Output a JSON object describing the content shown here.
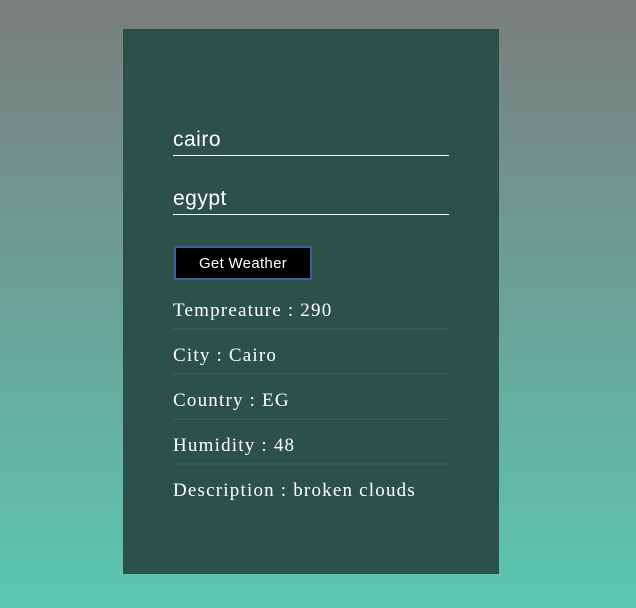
{
  "form": {
    "city_value": "cairo",
    "country_value": "egypt",
    "button_label": "Get Weather"
  },
  "results": {
    "temperature": "Tempreature : 290",
    "city": "City : Cairo",
    "country": "Country : EG",
    "humidity": "Humidity : 48",
    "description": "Description : broken clouds"
  },
  "colors": {
    "card_background": "#2c5149",
    "button_background": "#000000",
    "button_border": "#3f5f9e",
    "text": "#ffffff"
  }
}
